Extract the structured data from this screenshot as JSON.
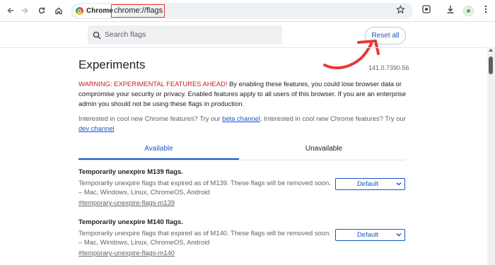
{
  "browser": {
    "chip_label": "Chrome",
    "url": "chrome://flags",
    "icons": [
      "back-icon",
      "forward-icon",
      "reload-icon",
      "home-icon",
      "bookmark-star-icon",
      "google-lens-icon",
      "download-icon",
      "extension-avatar-icon"
    ]
  },
  "header": {
    "search_placeholder": "Search flags",
    "reset_label": "Reset all"
  },
  "page": {
    "title": "Experiments",
    "version": "141.0.7390.56",
    "warning_prefix": "WARNING: EXPERIMENTAL FEATURES AHEAD!",
    "warning_text": " By enabling these features, you could lose browser data or compromise your security or privacy. Enabled features apply to all users of this browser. If you are an enterprise admin you should not be using these flags in production.",
    "interest_1": "Interested in cool new Chrome features? Try our ",
    "beta_link": "beta channel",
    "interest_2": ". Interested in cool new Chrome features? Try our ",
    "dev_link": "dev channel"
  },
  "tabs": [
    {
      "label": "Available",
      "active": true
    },
    {
      "label": "Unavailable",
      "active": false
    }
  ],
  "flags": [
    {
      "title": "Temporarily unexpire M139 flags.",
      "description": "Temporarily unexpire flags that expired as of M139. These flags will be removed soon. – Mac, Windows, Linux, ChromeOS, Android",
      "link": "#temporary-unexpire-flags-m139",
      "value": "Default"
    },
    {
      "title": "Temporarily unexpire M140 flags.",
      "description": "Temporarily unexpire flags that expired as of M140. These flags will be removed soon. – Mac, Windows, Linux, ChromeOS, Android",
      "link": "#temporary-unexpire-flags-m140",
      "value": "Default"
    }
  ],
  "colors": {
    "accent": "#1a56c5",
    "warning": "#c5221f",
    "annotation": "#e53935"
  }
}
